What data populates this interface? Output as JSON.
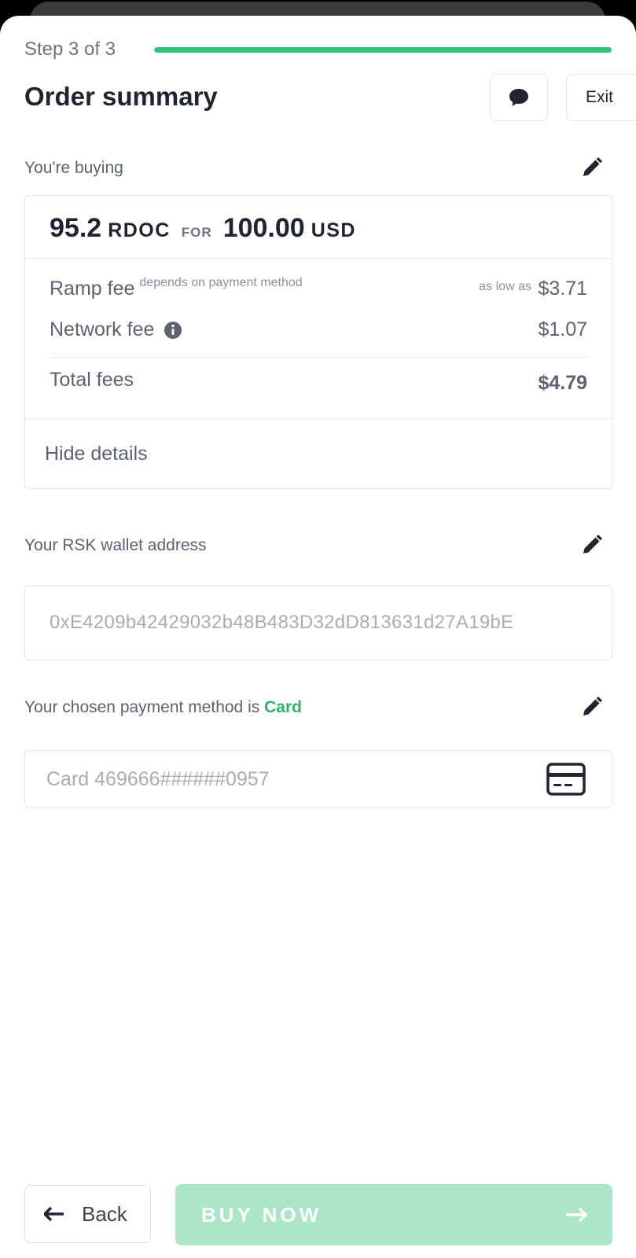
{
  "header": {
    "step_label": "Step 3 of 3",
    "progress": 1.0,
    "title": "Order summary",
    "exit_label": "Exit",
    "chat_icon": "chat-bubble-icon"
  },
  "buying": {
    "label": "You're buying",
    "crypto_amount": "95.2",
    "crypto_currency": "RDOC",
    "for_label": "FOR",
    "fiat_amount": "100.00",
    "fiat_currency": "USD",
    "fees": {
      "ramp_fee_label": "Ramp fee",
      "ramp_fee_note": "depends on payment method",
      "ramp_fee_prefix": "as low as",
      "ramp_fee_value": "$3.71",
      "network_fee_label": "Network fee",
      "network_fee_value": "$1.07",
      "total_label": "Total fees",
      "total_value": "$4.79"
    },
    "hide_details_label": "Hide details"
  },
  "wallet": {
    "label": "Your RSK wallet address",
    "address": "0xE4209b42429032b48B483D32dD813631d27A19bE"
  },
  "payment": {
    "label_prefix": "Your chosen payment method is",
    "method": "Card",
    "card_text": "Card 469666######0957"
  },
  "footer": {
    "back_label": "Back",
    "buy_label": "BUY NOW"
  },
  "colors": {
    "accent": "#2fc37a",
    "buy_button": "#aae6c7",
    "text_primary": "#1f2430",
    "text_muted": "#5b6272"
  }
}
